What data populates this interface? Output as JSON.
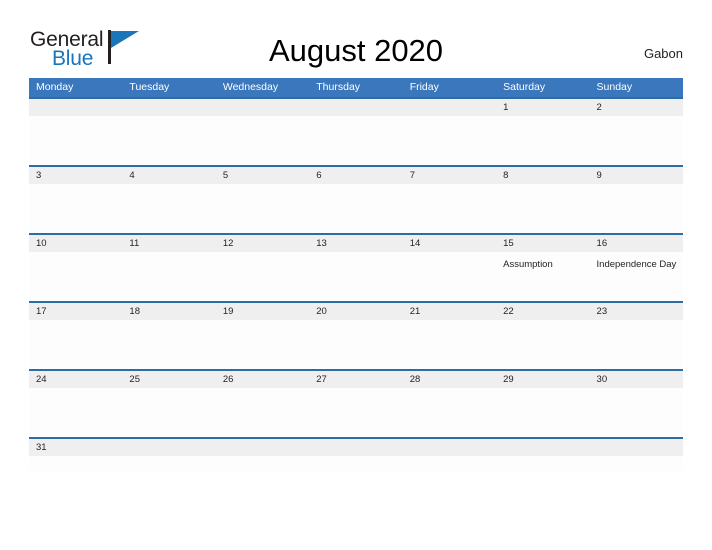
{
  "logo": {
    "word_one": "General",
    "word_two": "Blue"
  },
  "header": {
    "title": "August 2020",
    "country": "Gabon"
  },
  "colors": {
    "header_blue": "#3a77bd",
    "row_rule_blue": "#2e6ca4",
    "date_band_gray": "#efefef",
    "logo_blue": "#1b75bb",
    "text_dark": "#231f20"
  },
  "weekdays": [
    "Monday",
    "Tuesday",
    "Wednesday",
    "Thursday",
    "Friday",
    "Saturday",
    "Sunday"
  ],
  "weeks": [
    {
      "days": [
        {
          "date": "",
          "holiday": ""
        },
        {
          "date": "",
          "holiday": ""
        },
        {
          "date": "",
          "holiday": ""
        },
        {
          "date": "",
          "holiday": ""
        },
        {
          "date": "",
          "holiday": ""
        },
        {
          "date": "1",
          "holiday": ""
        },
        {
          "date": "2",
          "holiday": ""
        }
      ]
    },
    {
      "days": [
        {
          "date": "3",
          "holiday": ""
        },
        {
          "date": "4",
          "holiday": ""
        },
        {
          "date": "5",
          "holiday": ""
        },
        {
          "date": "6",
          "holiday": ""
        },
        {
          "date": "7",
          "holiday": ""
        },
        {
          "date": "8",
          "holiday": ""
        },
        {
          "date": "9",
          "holiday": ""
        }
      ]
    },
    {
      "days": [
        {
          "date": "10",
          "holiday": ""
        },
        {
          "date": "11",
          "holiday": ""
        },
        {
          "date": "12",
          "holiday": ""
        },
        {
          "date": "13",
          "holiday": ""
        },
        {
          "date": "14",
          "holiday": ""
        },
        {
          "date": "15",
          "holiday": "Assumption"
        },
        {
          "date": "16",
          "holiday": "Independence Day"
        }
      ]
    },
    {
      "days": [
        {
          "date": "17",
          "holiday": ""
        },
        {
          "date": "18",
          "holiday": ""
        },
        {
          "date": "19",
          "holiday": ""
        },
        {
          "date": "20",
          "holiday": ""
        },
        {
          "date": "21",
          "holiday": ""
        },
        {
          "date": "22",
          "holiday": ""
        },
        {
          "date": "23",
          "holiday": ""
        }
      ]
    },
    {
      "days": [
        {
          "date": "24",
          "holiday": ""
        },
        {
          "date": "25",
          "holiday": ""
        },
        {
          "date": "26",
          "holiday": ""
        },
        {
          "date": "27",
          "holiday": ""
        },
        {
          "date": "28",
          "holiday": ""
        },
        {
          "date": "29",
          "holiday": ""
        },
        {
          "date": "30",
          "holiday": ""
        }
      ]
    },
    {
      "days": [
        {
          "date": "31",
          "holiday": ""
        },
        {
          "date": "",
          "holiday": ""
        },
        {
          "date": "",
          "holiday": ""
        },
        {
          "date": "",
          "holiday": ""
        },
        {
          "date": "",
          "holiday": ""
        },
        {
          "date": "",
          "holiday": ""
        },
        {
          "date": "",
          "holiday": ""
        }
      ]
    }
  ]
}
